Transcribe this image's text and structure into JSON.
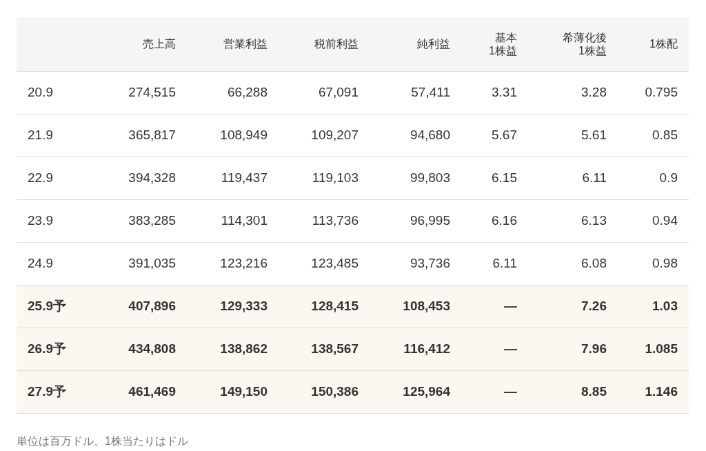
{
  "table": {
    "columns": [
      "",
      "売上高",
      "営業利益",
      "税前利益",
      "純利益",
      "基本\n1株益",
      "希薄化後\n1株益",
      "1株配"
    ],
    "rows": [
      {
        "forecast": false,
        "cells": [
          "20.9",
          "274,515",
          "66,288",
          "67,091",
          "57,411",
          "3.31",
          "3.28",
          "0.795"
        ]
      },
      {
        "forecast": false,
        "cells": [
          "21.9",
          "365,817",
          "108,949",
          "109,207",
          "94,680",
          "5.67",
          "5.61",
          "0.85"
        ]
      },
      {
        "forecast": false,
        "cells": [
          "22.9",
          "394,328",
          "119,437",
          "119,103",
          "99,803",
          "6.15",
          "6.11",
          "0.9"
        ]
      },
      {
        "forecast": false,
        "cells": [
          "23.9",
          "383,285",
          "114,301",
          "113,736",
          "96,995",
          "6.16",
          "6.13",
          "0.94"
        ]
      },
      {
        "forecast": false,
        "cells": [
          "24.9",
          "391,035",
          "123,216",
          "123,485",
          "93,736",
          "6.11",
          "6.08",
          "0.98"
        ]
      },
      {
        "forecast": true,
        "cells": [
          "25.9予",
          "407,896",
          "129,333",
          "128,415",
          "108,453",
          "—",
          "7.26",
          "1.03"
        ]
      },
      {
        "forecast": true,
        "cells": [
          "26.9予",
          "434,808",
          "138,862",
          "138,567",
          "116,412",
          "—",
          "7.96",
          "1.085"
        ]
      },
      {
        "forecast": true,
        "cells": [
          "27.9予",
          "461,469",
          "149,150",
          "150,386",
          "125,964",
          "—",
          "8.85",
          "1.146"
        ]
      }
    ]
  },
  "note": "単位は百万ドル、1株当たりはドル"
}
